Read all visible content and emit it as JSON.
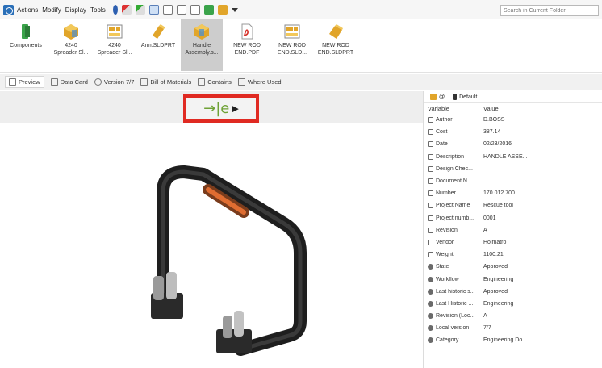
{
  "menubar": {
    "items": [
      "Actions",
      "Modify",
      "Display",
      "Tools"
    ],
    "toolbar_icons": [
      "pin-icon",
      "checkout-icon",
      "checkin-icon",
      "copy-icon",
      "document-icon",
      "file-icon",
      "document-icon",
      "green-file-icon",
      "multi-file-icon",
      "dropdown-arrow-icon"
    ]
  },
  "search": {
    "placeholder": "Search in Current Folder"
  },
  "ribbon": {
    "files": [
      {
        "label1": "Components",
        "label2": "",
        "icon": "components-icon",
        "color": "#3aa34a"
      },
      {
        "label1": "4240",
        "label2": "Spreader Sl...",
        "icon": "part-icon",
        "color": "#e1a52a"
      },
      {
        "label1": "4240",
        "label2": "Spreader Sl...",
        "icon": "drawing-icon",
        "color": "#e1a52a"
      },
      {
        "label1": "Arm.SLDPRT",
        "label2": "",
        "icon": "part-icon",
        "color": "#e1a52a"
      },
      {
        "label1": "Handle",
        "label2": "Assembly.s...",
        "icon": "assembly-icon",
        "color": "#e1a52a"
      },
      {
        "label1": "NEW ROD",
        "label2": "END.PDF",
        "icon": "pdf-icon",
        "color": "#d6322a"
      },
      {
        "label1": "NEW ROD",
        "label2": "END.SLD...",
        "icon": "drawing-icon",
        "color": "#e1a52a"
      },
      {
        "label1": "NEW ROD",
        "label2": "END.SLDPRT",
        "icon": "part-icon",
        "color": "#e1a52a"
      }
    ]
  },
  "tabs": [
    "Preview",
    "Data Card",
    "Version 7/7",
    "Bill of Materials",
    "Contains",
    "Where Used"
  ],
  "preview": {
    "badge_text": "→|e"
  },
  "props": {
    "tabs": [
      "@",
      "Default"
    ],
    "header": {
      "variable": "Variable",
      "value": "Value"
    },
    "rows": [
      {
        "var": "Author",
        "val": "D.BOSS",
        "icon": "prop"
      },
      {
        "var": "Cost",
        "val": "387.14",
        "icon": "prop"
      },
      {
        "var": "Date",
        "val": "02/23/2016",
        "icon": "prop"
      },
      {
        "var": "Description",
        "val": "HANDLE ASSE...",
        "icon": "prop"
      },
      {
        "var": "Design Chec...",
        "val": "",
        "icon": "prop"
      },
      {
        "var": "Document N...",
        "val": "",
        "icon": "prop"
      },
      {
        "var": "Number",
        "val": "170.012.700",
        "icon": "prop"
      },
      {
        "var": "Project Name",
        "val": "Rescue tool",
        "icon": "prop"
      },
      {
        "var": "Project numb...",
        "val": "0001",
        "icon": "prop"
      },
      {
        "var": "Revision",
        "val": "A",
        "icon": "prop"
      },
      {
        "var": "Vendor",
        "val": "Holmatro",
        "icon": "prop"
      },
      {
        "var": "Weight",
        "val": "1100.21",
        "icon": "prop"
      },
      {
        "var": "State",
        "val": "Approved",
        "icon": "circle"
      },
      {
        "var": "Workflow",
        "val": "Engineering",
        "icon": "circle"
      },
      {
        "var": "Last historic s...",
        "val": "Approved",
        "icon": "circle"
      },
      {
        "var": "Last Historic ...",
        "val": "Engineering",
        "icon": "circle"
      },
      {
        "var": "Revision (Loc...",
        "val": "A",
        "icon": "circle"
      },
      {
        "var": "Local version",
        "val": "7/7",
        "icon": "circle"
      },
      {
        "var": "Category",
        "val": "Engineering Do...",
        "icon": "circle"
      }
    ]
  }
}
